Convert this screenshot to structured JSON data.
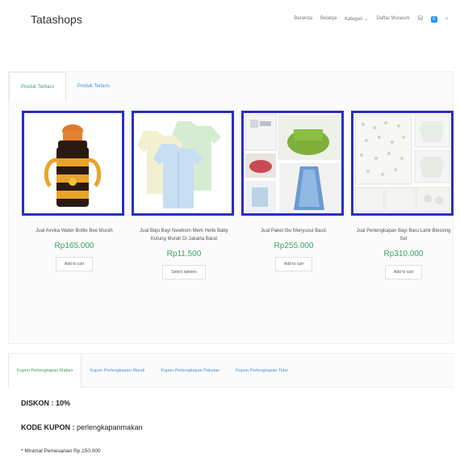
{
  "header": {
    "brand": "Tatashops",
    "nav": [
      "Beranda",
      "Belanja",
      "Kategori",
      "Daftar Museum"
    ],
    "cart_count": "0"
  },
  "section1": {
    "tabs": [
      "Produk Terbaru",
      "Produk Terlaris"
    ],
    "products": [
      {
        "name": "Jual Avvika Water Bottle Bee Murah",
        "price": "Rp165.000",
        "button": "Add to cart"
      },
      {
        "name": "Jual Baju Bayi Newborn Merk Hello Baby Kutung Murah Di Jakarta Barat",
        "price": "Rp11.500",
        "button": "Select options"
      },
      {
        "name": "Jual Paket Ibu Menyusui Basic",
        "price": "Rp255.000",
        "button": "Add to cart"
      },
      {
        "name": "Jual Perlengkapan Bayi Baru Lahir Blessing Set",
        "price": "Rp310.000",
        "button": "Add to cart"
      }
    ]
  },
  "section2": {
    "tabs": [
      "Kupon Perlengkapan Makan",
      "Kupon Perlengkapan Mandi",
      "Kupon Perlengkapan Pakaian",
      "Kupon Perlengkapan Tidur"
    ],
    "diskon": "DISKON : 10%",
    "kode_label": "KODE KUPON : ",
    "kode_value": "perlengkapanmakan",
    "minimal": "* Minimal Pemesanan Rp.150.000"
  },
  "colors": {
    "accent_green": "#3aa360",
    "link_blue": "#4a90d9",
    "image_border": "#2a2fbf",
    "badge_blue": "#2196f3"
  },
  "icons": [
    "cart-icon",
    "search-icon",
    "chevron-down-icon"
  ]
}
